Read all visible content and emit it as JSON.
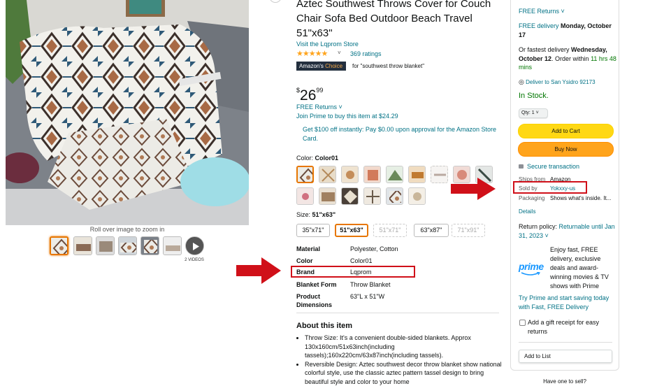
{
  "product": {
    "title": "Aztec Southwest Throws Cover for Couch Chair Sofa Bed Outdoor Beach Travel 51\"x63\"",
    "store_link": "Visit the Lqprom Store",
    "stars": "★★★★★",
    "rating_count": "369 ratings",
    "choice_badge_a": "Amazon's",
    "choice_badge_b": "Choice",
    "choice_for": "for \"southwest throw blanket\"",
    "price_symbol": "$",
    "price_whole": "26",
    "price_fraction": "99",
    "returns": "FREE Returns ˅",
    "prime_price": "Join Prime to buy this item at $24.29",
    "card_offer": "Get $100 off instantly: Pay $0.00 upon approval for the Amazon Store Card.",
    "color_label": "Color:",
    "color_value": "Color01",
    "size_label": "Size:",
    "size_value": "51\"x63\"",
    "sizes": [
      "35\"x71\"",
      "51\"x63\"",
      "51\"x71\"",
      "63\"x87\"",
      "71\"x91\""
    ],
    "specs": [
      {
        "key": "Material",
        "value": "Polyester, Cotton"
      },
      {
        "key": "Color",
        "value": "Color01"
      },
      {
        "key": "Brand",
        "value": "Lqprom"
      },
      {
        "key": "Blanket Form",
        "value": "Throw Blanket"
      },
      {
        "key": "Product Dimensions",
        "value": "63\"L x 51\"W"
      }
    ],
    "about_title": "About this item",
    "about_items": [
      "Throw Size: It's a convenient double-sided blankets. Approx 130x160cm/51x63inch(including tassels);160x220cm/63x87inch(including tassels).",
      "Reversible Design: Aztec southwest decor throw blanket show national colorful style, use the classic aztec pattern tassel design to bring beautiful style and color to your home"
    ]
  },
  "gallery": {
    "zoom_text": "Roll over image to zoom in",
    "videos_label": "2 VIDEOS"
  },
  "buybox": {
    "returns": "FREE Returns ˅",
    "delivery_prefix": "FREE delivery",
    "delivery_date": "Monday, October 17",
    "fastest_prefix": "Or fastest delivery",
    "fastest_date": "Wednesday, October 12",
    "order_within": ". Order within",
    "countdown": "11 hrs 48 mins",
    "deliver_to": "Deliver to San Ysidro 92173",
    "stock": "In Stock.",
    "qty": "Qty: 1 ˅",
    "add_to_cart": "Add to Cart",
    "buy_now": "Buy Now",
    "secure": "Secure transaction",
    "ships_from_k": "Ships from",
    "ships_from_v": "Amazon",
    "sold_by_k": "Sold by",
    "sold_by_v": "Yokxxy-us",
    "packaging_k": "Packaging",
    "packaging_v": "Shows what's inside. It...",
    "details": "Details",
    "return_policy_k": "Return policy:",
    "return_policy_v": "Returnable until Jan 31, 2023 ˅",
    "prime_logo": "prime",
    "prime_text": "Enjoy fast, FREE delivery, exclusive deals and award-winning movies & TV shows with Prime",
    "prime_try": "Try Prime and start saving today with Fast, FREE Delivery",
    "gift": "Add a gift receipt for easy returns",
    "add_to_list": "Add to List",
    "have_one": "Have one to sell?"
  },
  "colors": {
    "annotation_red": "#d01019",
    "accent_orange": "#e77600",
    "cart_yellow": "#ffd814",
    "buy_orange": "#ffa41c",
    "link_teal": "#007185",
    "stock_green": "#007600"
  }
}
